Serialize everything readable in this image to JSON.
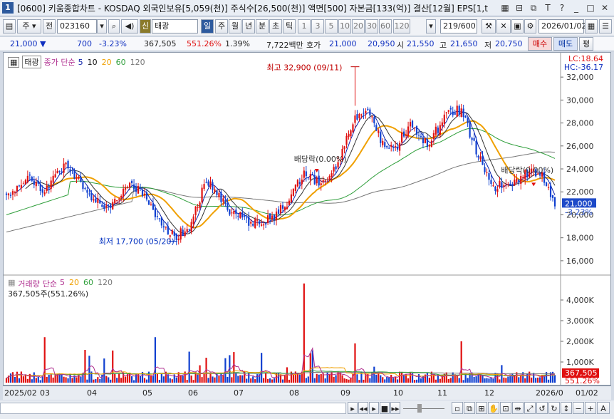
{
  "window": {
    "number": "1",
    "title": "[0600] 키움종합차트 - KOSDAQ 외국인보유[5,059(천)] 주식수[26,500(천)] 액면[500] 자본금[133(억)] 결산[12월] EPS[1,t",
    "icons": [
      "grid-icon",
      "pin-icon",
      "restore-icon",
      "text-icon",
      "help-icon",
      "minimize-icon",
      "maximize-icon",
      "close-icon"
    ]
  },
  "toolbar": {
    "market_label": "주",
    "prev_label": "전",
    "code": "023160",
    "stock_badge": "신",
    "stock_name": "태광",
    "periods": [
      "일",
      "주",
      "월",
      "년",
      "분",
      "초",
      "틱"
    ],
    "active_period": "일",
    "intervals": [
      "1",
      "3",
      "5",
      "10",
      "20",
      "30",
      "60",
      "120"
    ],
    "count": "219/600",
    "date": "2026/01/02"
  },
  "quote": {
    "price": "21,000",
    "change": "700",
    "change_pct": "-3.23%",
    "volume": "367,505",
    "volume_ratio": "551.26%",
    "turnover": "1.39%",
    "amount": "7,722백만",
    "bid_label": "호가",
    "ask": "21,000",
    "bid": "20,950",
    "open_label": "시",
    "open": "21,550",
    "high_label": "고",
    "high": "21,650",
    "low_label": "저",
    "low": "20,750",
    "buy_label": "매수",
    "sell_label": "매도",
    "eval_label": "평"
  },
  "price_pane": {
    "stock_tag": "태광",
    "ma_label": "종가 단순",
    "ma_periods": [
      "5",
      "10",
      "20",
      "60",
      "120"
    ],
    "lc": "LC:18.64",
    "hc": "HC:-36.17",
    "high_annotation": "최고 32,900 (09/11)",
    "low_annotation": "최저 17,700 (05/20)",
    "dividend1": "배당락(0.00%)",
    "dividend2": "배당락(0.00%)",
    "current_price": "21,000",
    "current_pct": "-3.23%"
  },
  "volume_pane": {
    "title": "거래량",
    "ma_label": "단순",
    "ma_periods": [
      "5",
      "20",
      "60",
      "120"
    ],
    "last": "367,505주(551.26%)",
    "current_vol": "367,505",
    "current_pct": "551.26%"
  },
  "date_axis": [
    "2025/02",
    "03",
    "04",
    "05",
    "06",
    "07",
    "08",
    "09",
    "10",
    "11",
    "12",
    "2026/0",
    "01/02"
  ],
  "colors": {
    "up": "#e01010",
    "down": "#1040d0",
    "ma5": "#0b1fa8",
    "ma20": "#f0a000",
    "ma60": "#2e9e3a",
    "ma120": "#777777"
  },
  "chart_data": [
    {
      "type": "candlestick",
      "title": "태광 일봉",
      "y_ticks": [
        16000,
        18000,
        20000,
        22000,
        24000,
        26000,
        28000,
        30000,
        32000
      ],
      "ylim": [
        15000,
        33500
      ],
      "price_path": [
        {
          "x": 0,
          "y": 21500
        },
        {
          "x": 10,
          "y": 23500
        },
        {
          "x": 18,
          "y": 22000
        },
        {
          "x": 28,
          "y": 24500
        },
        {
          "x": 38,
          "y": 22000
        },
        {
          "x": 48,
          "y": 20500
        },
        {
          "x": 58,
          "y": 22800
        },
        {
          "x": 66,
          "y": 21500
        },
        {
          "x": 74,
          "y": 18800
        },
        {
          "x": 80,
          "y": 18200
        },
        {
          "x": 86,
          "y": 18900
        },
        {
          "x": 94,
          "y": 23000
        },
        {
          "x": 104,
          "y": 20500
        },
        {
          "x": 116,
          "y": 19200
        },
        {
          "x": 126,
          "y": 19800
        },
        {
          "x": 134,
          "y": 21500
        },
        {
          "x": 140,
          "y": 23800
        },
        {
          "x": 148,
          "y": 22500
        },
        {
          "x": 156,
          "y": 24500
        },
        {
          "x": 164,
          "y": 28500
        },
        {
          "x": 170,
          "y": 29000
        },
        {
          "x": 176,
          "y": 26500
        },
        {
          "x": 182,
          "y": 25500
        },
        {
          "x": 190,
          "y": 28000
        },
        {
          "x": 198,
          "y": 26200
        },
        {
          "x": 208,
          "y": 28800
        },
        {
          "x": 214,
          "y": 29200
        },
        {
          "x": 222,
          "y": 25000
        },
        {
          "x": 230,
          "y": 22500
        },
        {
          "x": 238,
          "y": 22600
        },
        {
          "x": 246,
          "y": 23800
        },
        {
          "x": 252,
          "y": 23500
        },
        {
          "x": 258,
          "y": 21000
        }
      ],
      "volume_spikes": [
        {
          "x": 18,
          "value": 2200000
        },
        {
          "x": 70,
          "value": 2200000
        },
        {
          "x": 86,
          "value": 1500000
        },
        {
          "x": 140,
          "value": 4800000
        },
        {
          "x": 164,
          "value": 1900000
        },
        {
          "x": 214,
          "value": 2000000
        },
        {
          "x": 258,
          "value": 367505
        }
      ],
      "volume_ticks": [
        "1,000K",
        "2,000K",
        "3,000K",
        "4,000K"
      ]
    }
  ]
}
